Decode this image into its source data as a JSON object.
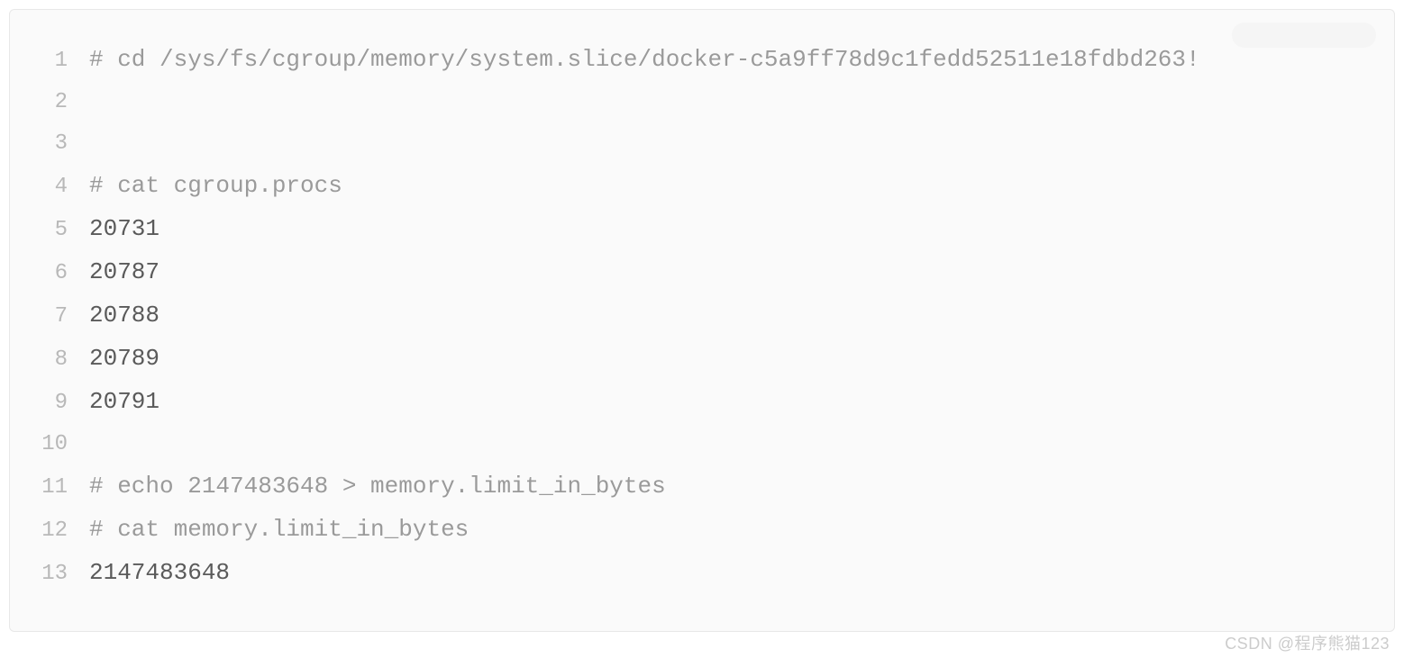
{
  "code": {
    "lines": [
      {
        "n": "1",
        "style": "comment",
        "text": "# cd /sys/fs/cgroup/memory/system.slice/docker-c5a9ff78d9c1fedd52511e18fdbd263!"
      },
      {
        "n": "2",
        "style": "comment",
        "text": ""
      },
      {
        "n": "3",
        "style": "comment",
        "text": ""
      },
      {
        "n": "4",
        "style": "comment",
        "text": "# cat cgroup.procs"
      },
      {
        "n": "5",
        "style": "output",
        "text": "20731"
      },
      {
        "n": "6",
        "style": "output",
        "text": "20787"
      },
      {
        "n": "7",
        "style": "output",
        "text": "20788"
      },
      {
        "n": "8",
        "style": "output",
        "text": "20789"
      },
      {
        "n": "9",
        "style": "output",
        "text": "20791"
      },
      {
        "n": "10",
        "style": "comment",
        "text": ""
      },
      {
        "n": "11",
        "style": "comment",
        "text": "# echo 2147483648 > memory.limit_in_bytes"
      },
      {
        "n": "12",
        "style": "comment",
        "text": "# cat memory.limit_in_bytes"
      },
      {
        "n": "13",
        "style": "output",
        "text": "2147483648"
      }
    ]
  },
  "watermark": "CSDN @程序熊猫123"
}
